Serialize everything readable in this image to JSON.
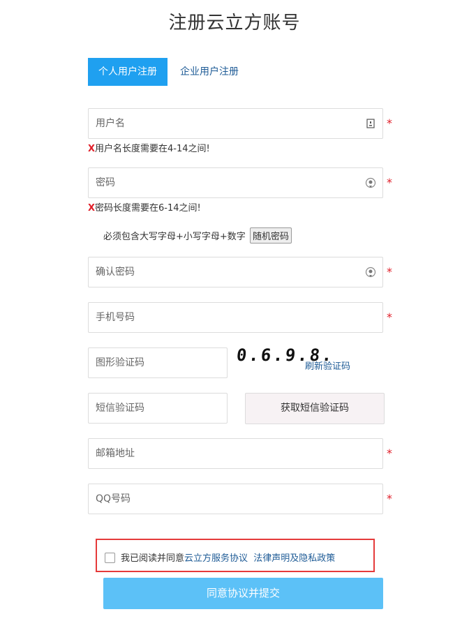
{
  "page": {
    "title": "注册云立方账号"
  },
  "tabs": [
    {
      "label": "个人用户注册",
      "active": true
    },
    {
      "label": "企业用户注册",
      "active": false
    }
  ],
  "form": {
    "required_mark": "*",
    "username": {
      "placeholder": "用户名",
      "value": "",
      "icon": "id-card-icon",
      "error_mark": "X",
      "error": "用户名长度需要在4-14之间!"
    },
    "password": {
      "placeholder": "密码",
      "value": "",
      "icon": "eye-icon",
      "error_mark": "X",
      "error": "密码长度需要在6-14之间!"
    },
    "password_hint": {
      "text": "必须包含大写字母+小写字母+数字",
      "random_button": "随机密码"
    },
    "confirm_password": {
      "placeholder": "确认密码",
      "value": "",
      "icon": "eye-icon"
    },
    "phone": {
      "placeholder": "手机号码",
      "value": ""
    },
    "captcha": {
      "placeholder": "图形验证码",
      "value": "",
      "image_text": "0.6.9.8.",
      "refresh_label": "刷新验证码"
    },
    "sms_code": {
      "placeholder": "短信验证码",
      "value": "",
      "button_label": "获取短信验证码"
    },
    "email": {
      "placeholder": "邮箱地址",
      "value": ""
    },
    "qq": {
      "placeholder": "QQ号码",
      "value": ""
    }
  },
  "agreement": {
    "checked": false,
    "prefix": "我已阅读并同意",
    "service_link": "云立方服务协议",
    "privacy_link": "法律声明及隐私政策"
  },
  "submit": {
    "label": "同意协议并提交"
  },
  "colors": {
    "primary": "#1fa0f0",
    "submit_bg": "#5cc1f7",
    "link": "#1e5b96",
    "error": "#e0202a",
    "highlight_border": "#e53a3a"
  }
}
